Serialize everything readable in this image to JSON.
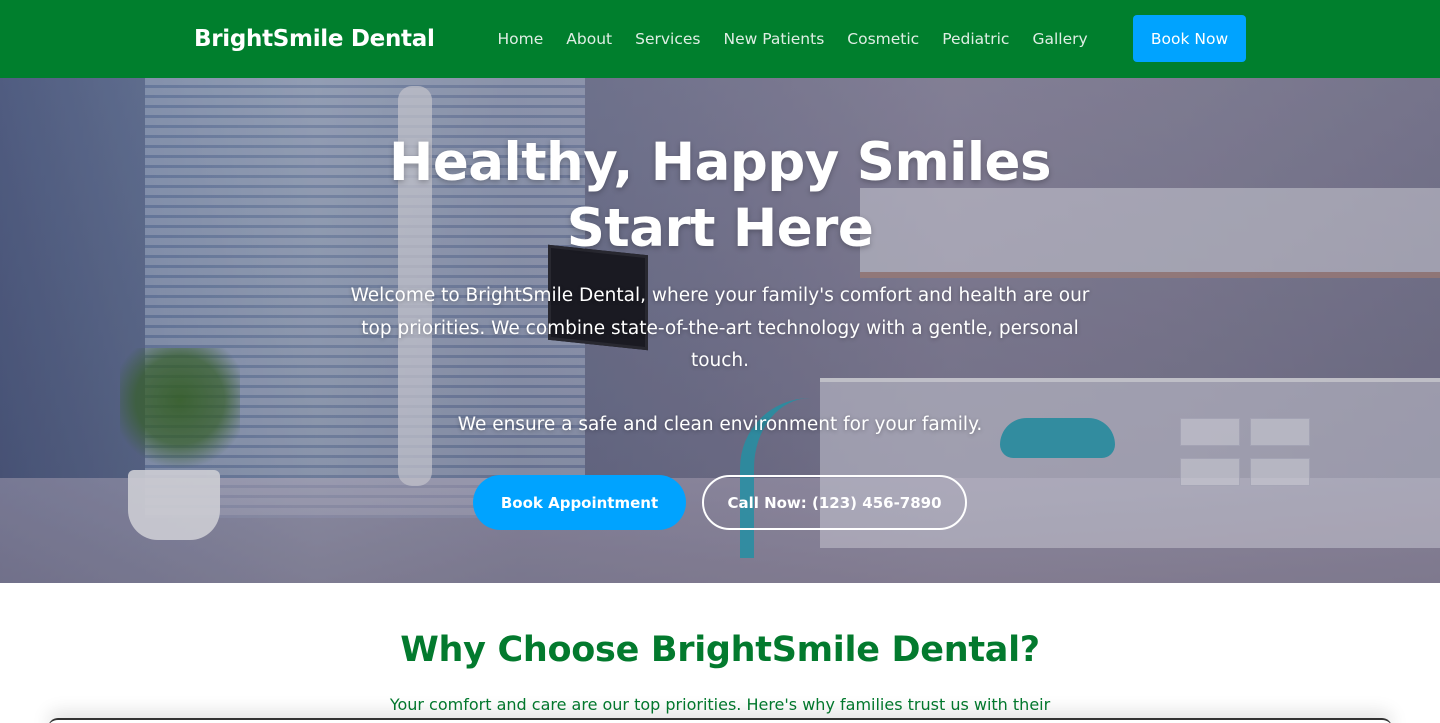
{
  "brand": "BrightSmile Dental",
  "nav": {
    "items": [
      "Home",
      "About",
      "Services",
      "New Patients",
      "Cosmetic",
      "Pediatric",
      "Gallery"
    ],
    "cta": "Book Now"
  },
  "hero": {
    "title": "Healthy, Happy Smiles Start Here",
    "text": "Welcome to BrightSmile Dental, where your family's comfort and health are our top priorities. We combine state-of-the-art technology with a gentle, personal touch.",
    "text2": "We ensure a safe and clean environment for your family.",
    "primary_button": "Book Appointment",
    "secondary_button": "Call Now: (123) 456-7890"
  },
  "why": {
    "title": "Why Choose BrightSmile Dental?",
    "text": "Your comfort and care are our top priorities. Here's why families trust us with their"
  },
  "colors": {
    "nav_bg": "#007f2d",
    "accent": "#00a3ff",
    "heading_green": "#037a2e"
  }
}
